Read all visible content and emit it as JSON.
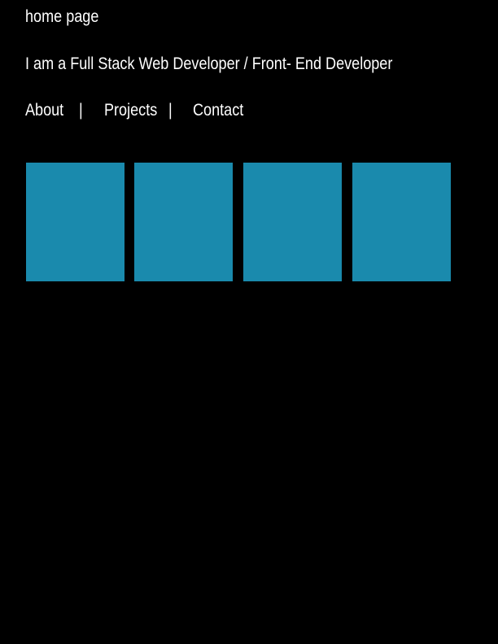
{
  "page": {
    "title": "home page",
    "tagline": "I am a Full Stack Web Developer / Front- End Developer",
    "background_color": "#000000",
    "text_color": "#ffffff"
  },
  "nav": {
    "items": [
      {
        "label": "About"
      },
      {
        "label": "Projects"
      },
      {
        "label": "Contact"
      }
    ],
    "separator": "|"
  },
  "tiles": {
    "color": "#1a8aad",
    "count": 4
  }
}
